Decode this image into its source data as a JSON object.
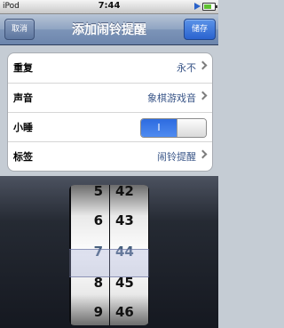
{
  "status_bar": {
    "device": "iPod",
    "time": "7:44",
    "play_icon": "play-icon",
    "battery_icon": "battery-icon"
  },
  "nav": {
    "title": "添加闹铃提醒",
    "cancel_label": "取消",
    "save_label": "储存",
    "accent_color": "#2a63cf"
  },
  "settings": {
    "rows": [
      {
        "label": "重复",
        "value": "永不"
      },
      {
        "label": "声音",
        "value": "象棋游戏音"
      },
      {
        "label": "小睡",
        "toggle_label": "I",
        "toggle_on": true
      },
      {
        "label": "标签",
        "value": "闹铃提醒"
      }
    ]
  },
  "picker": {
    "hours": [
      "5",
      "6",
      "7",
      "8",
      "9"
    ],
    "minutes": [
      "42",
      "43",
      "44",
      "45",
      "46"
    ],
    "selected_hour": "7",
    "selected_minute": "44"
  }
}
